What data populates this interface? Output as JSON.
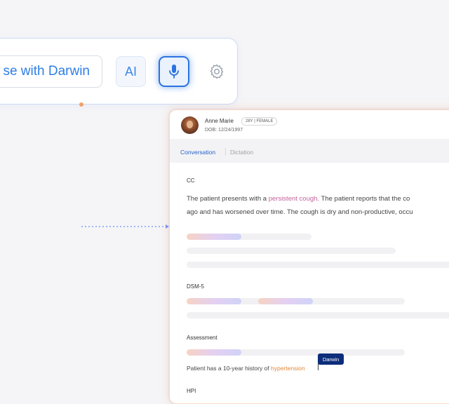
{
  "toolbar": {
    "input_text": "se with Darwin",
    "ai_label": "AI",
    "mic_icon": "microphone-icon",
    "settings_icon": "gear-icon"
  },
  "patient": {
    "name": "Anne Marie",
    "badge": "28Y | FEMALE",
    "dob": "DOB: 12/24/1997"
  },
  "tabs": [
    {
      "label": "Conversation",
      "active": true
    },
    {
      "label": "Dictation",
      "active": false
    }
  ],
  "sections": {
    "cc": {
      "label": "CC",
      "line1_pre": "The patient presents with a ",
      "line1_highlight": "persistent cough.",
      "line1_post": " The patient reports that the co",
      "line2": "ago and has worsened over time. The cough is dry and non-productive, occu"
    },
    "dsm": {
      "label": "DSM-5"
    },
    "assessment": {
      "label": "Assessment",
      "tooltip": "Darwin",
      "text_pre": "Patient has a 10-year history of ",
      "text_highlight": "hypertension"
    },
    "hpi": {
      "label": "HPI"
    }
  },
  "colors": {
    "accent": "#2b73df",
    "tab_active": "#2563c9",
    "highlight_cough": "#c2649a",
    "highlight_hypertension": "#e0893a",
    "tooltip_bg": "#0d2d7a"
  }
}
